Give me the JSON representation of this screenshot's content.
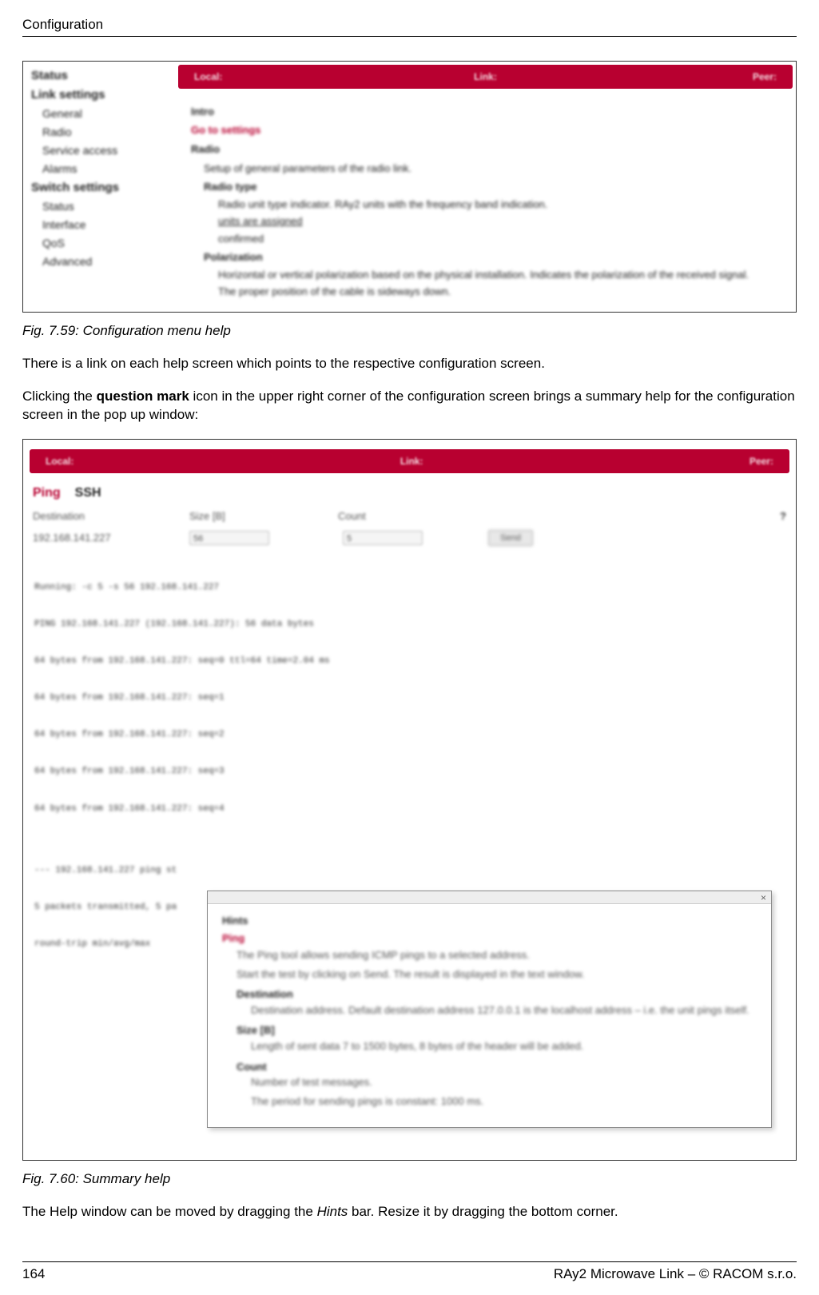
{
  "header": {
    "section": "Configuration"
  },
  "fig1": {
    "nav_headings": [
      "Status",
      "Link settings",
      "Switch settings"
    ],
    "nav_items1": [
      "General",
      "Radio",
      "Service access",
      "Alarms"
    ],
    "nav_items2": [
      "Status",
      "Interface",
      "QoS",
      "Advanced"
    ],
    "redbar": {
      "local": "Local:",
      "link": "Link:",
      "peer": "Peer:"
    },
    "content": {
      "intro": "Intro",
      "goto": "Go to settings",
      "radio_h": "Radio",
      "radio_t": "Setup of general parameters of the radio link.",
      "rt_h": "Radio type",
      "rt_t": "Radio unit type indicator. RAy2 units with the frequency band indication.",
      "rt_u": "units are assigned",
      "rt_c": "confirmed",
      "pol_h": "Polarization",
      "pol_t1": "Horizontal or vertical polarization based on the physical installation. Indicates the polarization of the received signal.",
      "pol_t2": "The proper position of the cable is sideways down."
    }
  },
  "caption1": "Fig. 7.59: Configuration menu help",
  "para1": "There is a link on each help screen which points to the respective configuration screen.",
  "para2_a": "Clicking the ",
  "para2_b": "question mark",
  "para2_c": " icon in the upper right corner of the configuration screen brings a summary help for the configuration screen in the pop up window:",
  "fig2": {
    "redbar": {
      "local": "Local:",
      "link": "Link:",
      "peer": "Peer:"
    },
    "tabs": {
      "ping": "Ping",
      "ssh": "SSH"
    },
    "form": {
      "dest_l": "Destination",
      "size_l": "Size [B]",
      "count_l": "Count",
      "dest_v": "192.168.141.227",
      "size_v": "56",
      "count_v": "5",
      "btn": "Send"
    },
    "term_lines": [
      "Running: -c 5 -s 56 192.168.141.227",
      "PING 192.168.141.227 (192.168.141.227): 56 data bytes",
      "64 bytes from 192.168.141.227: seq=0 ttl=64 time=2.04 ms",
      "64 bytes from 192.168.141.227: seq=1",
      "64 bytes from 192.168.141.227: seq=2",
      "64 bytes from 192.168.141.227: seq=3",
      "64 bytes from 192.168.141.227: seq=4",
      "",
      "--- 192.168.141.227 ping st",
      "5 packets transmitted, 5 pa",
      "round-trip min/avg/max"
    ],
    "popup": {
      "hints": "Hints",
      "ping_h": "Ping",
      "ping_t1": "The Ping tool allows sending ICMP pings to a selected address.",
      "ping_t2": "Start the test by clicking on Send. The result is displayed in the text window.",
      "dest_h": "Destination",
      "dest_t": "Destination address. Default destination address 127.0.0.1 is the localhost address – i.e. the unit pings itself.",
      "size_h": "Size [B]",
      "size_t": "Length of sent data 7 to 1500 bytes, 8 bytes of the header will be added.",
      "count_h": "Count",
      "count_t1": "Number of test messages.",
      "count_t2": "The period for sending pings is constant: 1000 ms."
    }
  },
  "caption2": "Fig. 7.60: Summary help",
  "para3_a": "The Help window can be moved by dragging the ",
  "para3_b": "Hints",
  "para3_c": " bar. Resize it by dragging the bottom corner.",
  "footer": {
    "page": "164",
    "right": "RAy2 Microwave Link – © RACOM s.r.o."
  }
}
